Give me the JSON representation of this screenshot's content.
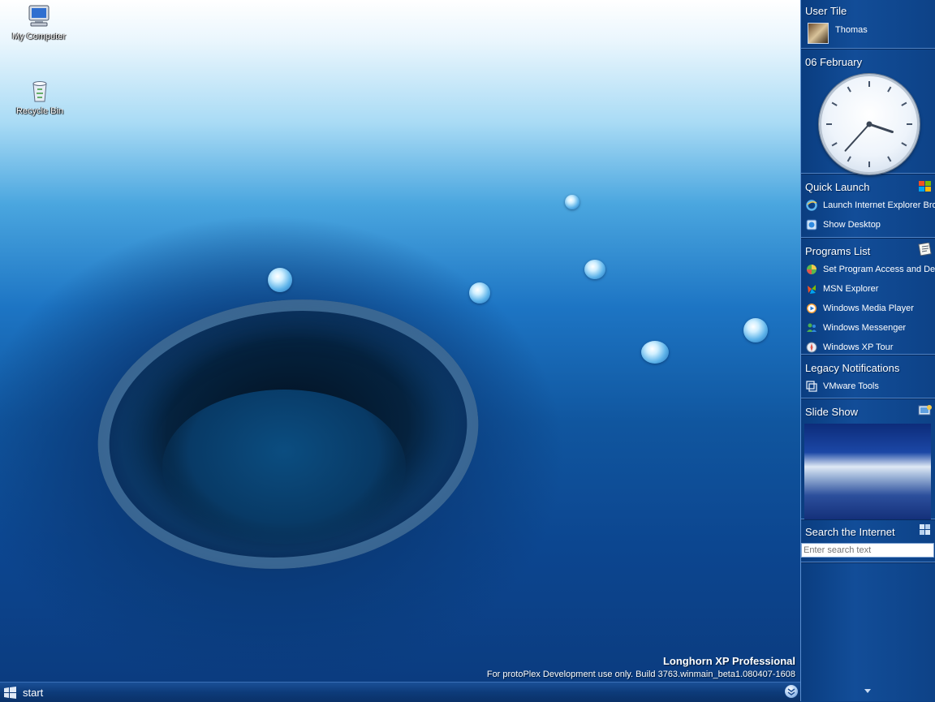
{
  "desktop": {
    "icons": [
      {
        "label": "My Computer",
        "icon": "my-computer-icon"
      },
      {
        "label": "Recycle Bin",
        "icon": "recycle-bin-icon"
      }
    ],
    "watermark": {
      "title": "Longhorn XP Professional",
      "build": "For protoPlex Development use only. Build 3763.winmain_beta1.080407-1608"
    }
  },
  "sidebar": {
    "user_tile": {
      "title": "User Tile",
      "user_name": "Thomas"
    },
    "clock": {
      "date": "06 February",
      "hour": 3,
      "minute": 37
    },
    "quick_launch": {
      "title": "Quick Launch",
      "items": [
        {
          "label": "Launch Internet Explorer Browser",
          "icon": "internet-explorer-icon"
        },
        {
          "label": "Show Desktop",
          "icon": "show-desktop-icon"
        }
      ]
    },
    "programs_list": {
      "title": "Programs List",
      "items": [
        {
          "label": "Set Program Access and Defaults",
          "icon": "program-access-icon"
        },
        {
          "label": "MSN Explorer",
          "icon": "msn-explorer-icon"
        },
        {
          "label": "Windows Media Player",
          "icon": "media-player-icon"
        },
        {
          "label": "Windows Messenger",
          "icon": "messenger-icon"
        },
        {
          "label": "Windows XP Tour",
          "icon": "xp-tour-icon"
        }
      ]
    },
    "legacy_notifications": {
      "title": "Legacy Notifications",
      "items": [
        {
          "label": "VMware Tools",
          "icon": "vmware-tools-icon"
        }
      ]
    },
    "slide_show": {
      "title": "Slide Show"
    },
    "search": {
      "title": "Search the Internet",
      "placeholder": "Enter search text"
    }
  },
  "taskbar": {
    "start_label": "start"
  },
  "colors": {
    "sidebar_bg": "#124d98",
    "taskbar_bg": "#0d3b7a",
    "accent": "#4aa6df"
  }
}
